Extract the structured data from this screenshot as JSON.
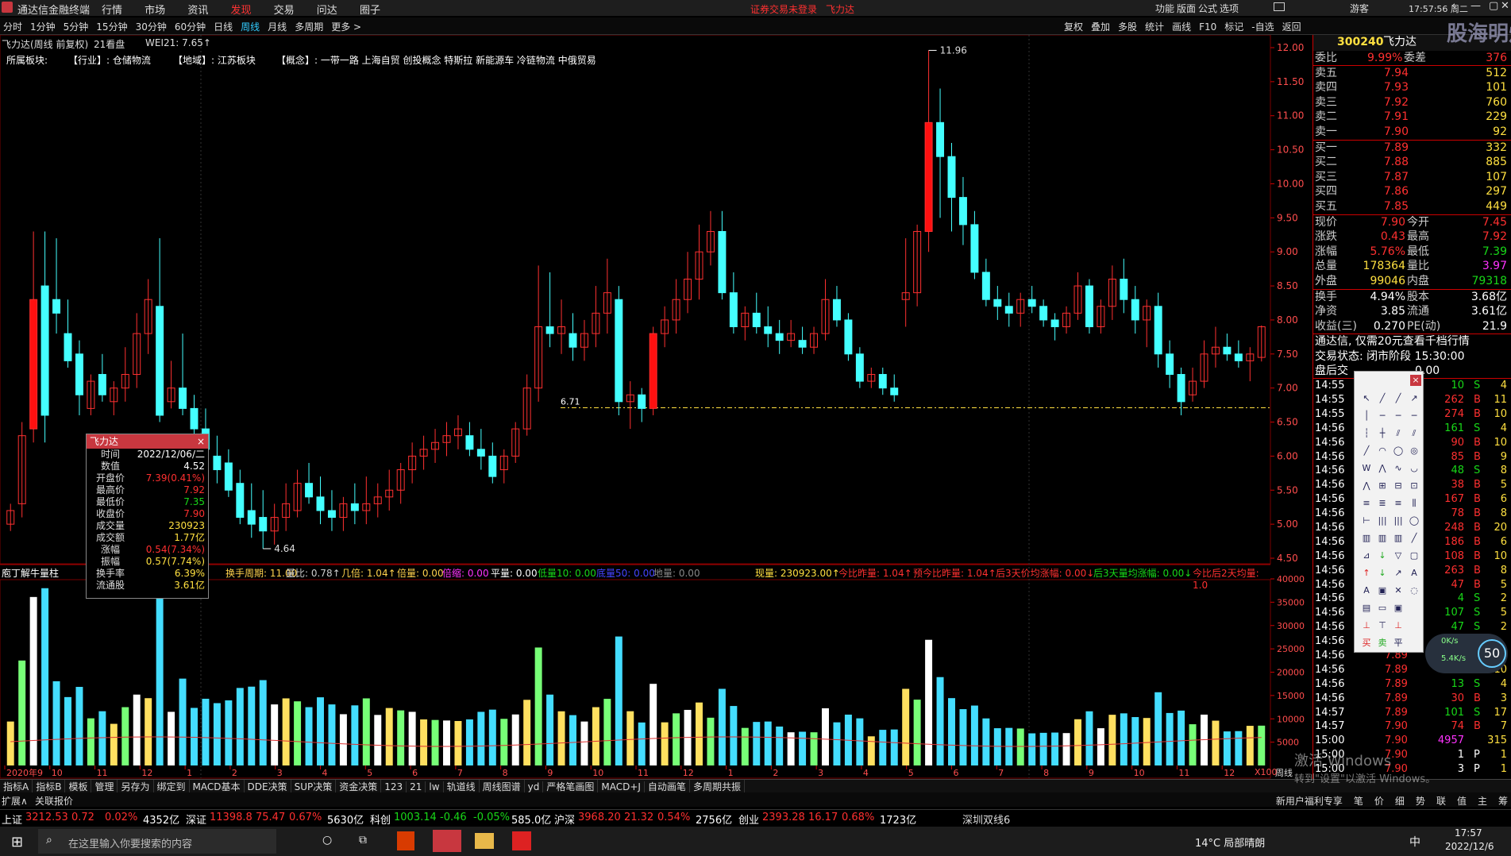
{
  "app": {
    "title": "通达信金融终端",
    "menu": [
      "行情",
      "市场",
      "资讯",
      "发现",
      "交易",
      "问达",
      "圈子"
    ],
    "center_notice": "证券交易未登录",
    "center_stock": "飞力达",
    "right_menu": [
      "功能",
      "版面",
      "公式",
      "选项"
    ],
    "user": "游客",
    "clock": "17:57:56 周二"
  },
  "period_tabs": [
    "分时",
    "1分钟",
    "5分钟",
    "15分钟",
    "30分钟",
    "60分钟",
    "日线",
    "周线",
    "月线",
    "多周期",
    "更多 >"
  ],
  "active_period": "周线",
  "toolbar_right": [
    "复权",
    "叠加",
    "多股",
    "统计",
    "画线",
    "F10",
    "标记",
    "-自选",
    "返回"
  ],
  "stock_info": {
    "name": "飞力达(周线 前复权)",
    "seal": "21看盘",
    "indicator": "WEI21: 7.65↑"
  },
  "sectors": {
    "label": "所属板块:",
    "industry": "【行业】: 仓储物流",
    "region": "【地域】: 江苏板块",
    "concept": "【概念】: 一带一路 上海自贸 创投概念 特斯拉 新能源车 冷链物流 中俄贸易"
  },
  "price_axis": [
    "12.00",
    "11.50",
    "11.00",
    "10.50",
    "10.00",
    "9.50",
    "9.00",
    "8.50",
    "8.00",
    "7.50",
    "7.00",
    "6.50",
    "6.00",
    "5.50",
    "5.00",
    "4.50"
  ],
  "price_marks": {
    "high": "11.96",
    "low": "4.64",
    "level": "6.71"
  },
  "volume_axis": [
    "40000",
    "35000",
    "30000",
    "25000",
    "20000",
    "15000",
    "10000",
    "5000",
    "X100"
  ],
  "x_axis_labels": [
    "2020年9",
    "10",
    "11",
    "12",
    "1",
    "2",
    "3",
    "4",
    "5",
    "6",
    "7",
    "8",
    "9",
    "10",
    "11",
    "12",
    "1",
    "2",
    "3",
    "4",
    "5",
    "6",
    "7",
    "8",
    "9",
    "10",
    "11",
    "12"
  ],
  "volume_indicator": {
    "name": "庖丁解牛量柱",
    "items": [
      "换手周期: 11.00",
      "量比: 0.78↑",
      "几倍: 1.04↑",
      "倍量: 0.00",
      "倍缩: 0.00",
      "平量: 0.00",
      "低量10: 0.00",
      "底量50: 0.00",
      "地量: 0.00",
      "现量: 230923.00↑",
      "今比昨量: 1.04↑",
      "预今比昨量: 1.04↑",
      "后3天价均涨幅: 0.00↓",
      "后3天量均涨幅: 0.00↓",
      "今比后2天均量: 1.0"
    ]
  },
  "popup": {
    "title": "飞力达",
    "rows": [
      [
        "时间",
        "2022/12/06/二"
      ],
      [
        "数值",
        "4.52"
      ],
      [
        "开盘价",
        "7.39(0.41%)"
      ],
      [
        "最高价",
        "7.92"
      ],
      [
        "最低价",
        "7.35"
      ],
      [
        "收盘价",
        "7.90"
      ],
      [
        "成交量",
        "230923"
      ],
      [
        "成交额",
        "1.77亿"
      ],
      [
        "涨幅",
        "0.54(7.34%)"
      ],
      [
        "振幅",
        "0.57(7.74%)"
      ],
      [
        "换手率",
        "6.39%"
      ],
      [
        "流通股",
        "3.61亿"
      ]
    ]
  },
  "quote": {
    "code": "300240",
    "name": "飞力达",
    "weibi": [
      "委比",
      "9.99%",
      "委差",
      "376"
    ],
    "asks": [
      [
        "卖五",
        "7.94",
        "512"
      ],
      [
        "卖四",
        "7.93",
        "101"
      ],
      [
        "卖三",
        "7.92",
        "760"
      ],
      [
        "卖二",
        "7.91",
        "229"
      ],
      [
        "卖一",
        "7.90",
        "92"
      ]
    ],
    "bids": [
      [
        "买一",
        "7.89",
        "332"
      ],
      [
        "买二",
        "7.88",
        "885"
      ],
      [
        "买三",
        "7.87",
        "107"
      ],
      [
        "买四",
        "7.86",
        "297"
      ],
      [
        "买五",
        "7.85",
        "449"
      ]
    ],
    "stats": [
      [
        "现价",
        "7.90",
        "今开",
        "7.45"
      ],
      [
        "涨跌",
        "0.43",
        "最高",
        "7.92"
      ],
      [
        "涨幅",
        "5.76%",
        "最低",
        "7.39"
      ],
      [
        "总量",
        "178364",
        "量比",
        "3.97"
      ],
      [
        "外盘",
        "99046",
        "内盘",
        "79318"
      ]
    ],
    "stats2": [
      [
        "换手",
        "4.94%",
        "股本",
        "3.68亿"
      ],
      [
        "净资",
        "3.85",
        "流通",
        "3.61亿"
      ],
      [
        "收益(三)",
        "0.270",
        "PE(动)",
        "21.9"
      ]
    ],
    "notice": "通达信, 仅需20元查看千档行情",
    "trade_state": "交易状态: 闭市阶段 15:30:00",
    "after_hours": "盘后交",
    "after_hours_value": "0.00",
    "ticks": [
      [
        "14:55",
        "",
        "10",
        "S",
        "4"
      ],
      [
        "14:55",
        "",
        "262",
        "B",
        "11"
      ],
      [
        "14:55",
        "",
        "274",
        "B",
        "10"
      ],
      [
        "14:56",
        "",
        "161",
        "S",
        "4"
      ],
      [
        "14:56",
        "",
        "90",
        "B",
        "10"
      ],
      [
        "14:56",
        "",
        "85",
        "B",
        "9"
      ],
      [
        "14:56",
        "",
        "48",
        "S",
        "8"
      ],
      [
        "14:56",
        "",
        "38",
        "B",
        "5"
      ],
      [
        "14:56",
        "",
        "167",
        "B",
        "6"
      ],
      [
        "14:56",
        "",
        "78",
        "B",
        "8"
      ],
      [
        "14:56",
        "",
        "248",
        "B",
        "20"
      ],
      [
        "14:56",
        "",
        "186",
        "B",
        "6"
      ],
      [
        "14:56",
        "",
        "108",
        "B",
        "10"
      ],
      [
        "14:56",
        "",
        "263",
        "B",
        "8"
      ],
      [
        "14:56",
        "",
        "47",
        "B",
        "5"
      ],
      [
        "14:56",
        "",
        "4",
        "S",
        "2"
      ],
      [
        "14:56",
        "",
        "107",
        "S",
        "5"
      ],
      [
        "14:56",
        "",
        "47",
        "S",
        "2"
      ],
      [
        "14:56",
        "",
        "",
        "",
        ""
      ],
      [
        "14:56",
        "7.89",
        "",
        "",
        ""
      ],
      [
        "14:56",
        "7.89",
        "273",
        "B",
        "10"
      ],
      [
        "14:56",
        "7.89",
        "13",
        "S",
        "4"
      ],
      [
        "14:56",
        "7.89",
        "30",
        "B",
        "3"
      ],
      [
        "14:57",
        "7.89",
        "101",
        "S",
        "17"
      ],
      [
        "14:57",
        "7.90",
        "74",
        "B",
        "7"
      ],
      [
        "15:00",
        "7.90",
        "4957",
        "",
        "315"
      ],
      [
        "15:00",
        "7.90",
        "1",
        "P",
        "1"
      ],
      [
        "15:00",
        "7.90",
        "3",
        "P",
        "1"
      ]
    ]
  },
  "bottom_tabs1": [
    "指标A",
    "指标B",
    "模板",
    "管理",
    "另存为",
    "绑定到",
    "MACD基本",
    "DDE决策",
    "SUP决策",
    "资金决策",
    "123",
    "21",
    "lw",
    "轨道线",
    "周线图谱",
    "yd",
    "严格笔画图",
    "MACD+J",
    "自动画笔",
    "多周期共振"
  ],
  "bottom_tabs2": [
    "扩展∧",
    "关联报价"
  ],
  "bottom_right_tabs": [
    "新用户福利专享",
    "笔",
    "价",
    "细",
    "势",
    "联",
    "值",
    "主",
    "筹"
  ],
  "status": [
    [
      "上证",
      "3212.53",
      "0.72",
      "0.02%",
      "4352亿"
    ],
    [
      "深证",
      "11398.8",
      "75.47",
      "0.67%",
      "5630亿"
    ],
    [
      "科创",
      "1003.14",
      "-0.46",
      "-0.05%",
      "585.0亿"
    ],
    [
      "沪深",
      "3968.20",
      "21.32",
      "0.54%",
      "2756亿"
    ],
    [
      "创业",
      "2393.28",
      "16.17",
      "0.68%",
      "1723亿"
    ]
  ],
  "status_right": "深圳双线6",
  "taskbar": {
    "search_placeholder": "在这里输入你要搜索的内容",
    "weather": "14°C 局部晴朗",
    "time": "17:57",
    "date": "2022/12/6",
    "ime": "中"
  },
  "watermark": [
    "激活 Windows",
    "转到\"设置\"以激活 Windows。"
  ],
  "net_speed": [
    "0K/s",
    "5.4K/s"
  ],
  "net_percent": "50",
  "cursor_label": "周线",
  "right_logo": "股海明灯",
  "colors": {
    "up": "#ff3030",
    "down": "#44ffff",
    "accent": "#c8373f"
  },
  "chart_data": {
    "type": "candlestick",
    "period": "weekly",
    "ylim": [
      4.5,
      12.0
    ],
    "ohlc": [
      [
        5.0,
        5.3,
        4.9,
        5.2
      ],
      [
        5.3,
        6.5,
        5.1,
        6.3
      ],
      [
        6.4,
        9.3,
        6.2,
        8.3
      ],
      [
        8.5,
        9.3,
        6.2,
        6.6
      ],
      [
        8.3,
        9.2,
        7.8,
        8.1
      ],
      [
        7.8,
        8.3,
        7.3,
        7.4
      ],
      [
        7.5,
        7.7,
        6.6,
        6.9
      ],
      [
        6.7,
        7.2,
        6.6,
        7.1
      ],
      [
        7.2,
        7.5,
        6.8,
        6.9
      ],
      [
        6.8,
        7.1,
        6.6,
        7.0
      ],
      [
        7.0,
        7.6,
        6.8,
        7.2
      ],
      [
        7.2,
        8.1,
        7.0,
        7.8
      ],
      [
        7.8,
        8.6,
        7.5,
        8.3
      ],
      [
        8.2,
        9.2,
        6.5,
        6.6
      ],
      [
        6.8,
        7.4,
        6.7,
        7.0
      ],
      [
        7.0,
        7.8,
        6.6,
        6.7
      ],
      [
        6.7,
        6.9,
        6.2,
        6.4
      ],
      [
        6.4,
        6.7,
        5.9,
        6.1
      ],
      [
        6.0,
        6.3,
        5.6,
        5.8
      ],
      [
        5.9,
        6.1,
        5.4,
        5.5
      ],
      [
        5.6,
        5.8,
        5.0,
        5.1
      ],
      [
        5.2,
        5.6,
        4.8,
        5.0
      ],
      [
        5.1,
        5.5,
        4.64,
        4.9
      ],
      [
        4.9,
        5.3,
        4.7,
        5.1
      ],
      [
        5.1,
        5.6,
        4.9,
        5.3
      ],
      [
        5.2,
        5.8,
        5.1,
        5.6
      ],
      [
        5.6,
        5.9,
        5.3,
        5.4
      ],
      [
        5.4,
        5.7,
        5.0,
        5.2
      ],
      [
        5.2,
        5.5,
        4.9,
        5.1
      ],
      [
        5.1,
        5.4,
        4.9,
        5.3
      ],
      [
        5.3,
        5.6,
        5.0,
        5.2
      ],
      [
        5.2,
        5.7,
        5.0,
        5.3
      ],
      [
        5.3,
        5.6,
        5.1,
        5.4
      ],
      [
        5.4,
        5.8,
        5.2,
        5.5
      ],
      [
        5.5,
        5.9,
        5.3,
        5.8
      ],
      [
        5.8,
        6.2,
        5.6,
        6.0
      ],
      [
        6.0,
        6.3,
        5.8,
        6.1
      ],
      [
        6.1,
        6.4,
        5.9,
        6.2
      ],
      [
        6.2,
        6.5,
        6.0,
        6.3
      ],
      [
        6.3,
        6.6,
        6.1,
        6.4
      ],
      [
        6.3,
        6.5,
        6.0,
        6.1
      ],
      [
        6.1,
        6.4,
        5.8,
        6.0
      ],
      [
        6.0,
        6.2,
        5.6,
        5.7
      ],
      [
        5.8,
        6.1,
        5.6,
        6.0
      ],
      [
        6.0,
        6.5,
        5.9,
        6.4
      ],
      [
        6.4,
        7.2,
        6.3,
        7.0
      ],
      [
        7.0,
        8.8,
        6.8,
        7.9
      ],
      [
        7.9,
        8.7,
        7.6,
        7.8
      ],
      [
        7.8,
        8.3,
        7.5,
        7.9
      ],
      [
        7.8,
        8.1,
        7.4,
        7.6
      ],
      [
        7.6,
        8.0,
        7.4,
        7.8
      ],
      [
        7.8,
        8.5,
        7.6,
        8.1
      ],
      [
        8.1,
        8.9,
        7.8,
        8.4
      ],
      [
        8.3,
        8.5,
        6.6,
        6.8
      ],
      [
        6.8,
        7.1,
        6.4,
        6.9
      ],
      [
        6.9,
        7.0,
        6.5,
        6.7
      ],
      [
        6.7,
        7.9,
        6.6,
        7.8
      ],
      [
        7.8,
        8.2,
        7.6,
        8.0
      ],
      [
        8.0,
        8.6,
        7.8,
        8.3
      ],
      [
        8.3,
        9.0,
        8.1,
        8.6
      ],
      [
        8.6,
        9.4,
        8.3,
        9.0
      ],
      [
        9.0,
        9.6,
        8.8,
        9.3
      ],
      [
        9.3,
        9.6,
        8.3,
        8.4
      ],
      [
        8.4,
        8.7,
        7.8,
        7.9
      ],
      [
        7.9,
        8.2,
        7.7,
        8.1
      ],
      [
        8.1,
        8.4,
        7.8,
        7.9
      ],
      [
        7.9,
        8.2,
        7.6,
        7.8
      ],
      [
        7.8,
        8.0,
        7.5,
        7.7
      ],
      [
        7.7,
        8.0,
        7.6,
        7.8
      ],
      [
        7.7,
        7.9,
        7.5,
        7.6
      ],
      [
        7.6,
        7.9,
        7.5,
        7.8
      ],
      [
        7.8,
        8.6,
        7.7,
        8.3
      ],
      [
        8.3,
        8.5,
        7.9,
        8.0
      ],
      [
        8.0,
        8.1,
        7.4,
        7.5
      ],
      [
        7.5,
        7.6,
        7.0,
        7.1
      ],
      [
        7.1,
        7.3,
        7.0,
        7.2
      ],
      [
        7.2,
        7.3,
        6.9,
        7.0
      ],
      [
        7.0,
        7.2,
        6.8,
        6.9
      ],
      [
        8.3,
        9.2,
        7.9,
        8.4
      ],
      [
        8.4,
        9.4,
        8.2,
        9.3
      ],
      [
        9.3,
        11.96,
        9.0,
        10.9
      ],
      [
        10.9,
        11.4,
        9.5,
        10.4
      ],
      [
        10.4,
        10.6,
        9.3,
        9.8
      ],
      [
        9.8,
        10.1,
        9.1,
        9.4
      ],
      [
        9.4,
        9.6,
        8.6,
        8.7
      ],
      [
        8.7,
        8.9,
        8.2,
        8.3
      ],
      [
        8.3,
        8.5,
        8.0,
        8.2
      ],
      [
        8.2,
        8.4,
        7.9,
        8.1
      ],
      [
        8.1,
        8.4,
        7.9,
        8.3
      ],
      [
        8.3,
        8.5,
        8.1,
        8.2
      ],
      [
        8.2,
        8.3,
        7.9,
        8.0
      ],
      [
        8.0,
        8.1,
        7.7,
        7.9
      ],
      [
        7.9,
        8.2,
        7.8,
        8.1
      ],
      [
        8.1,
        8.7,
        8.0,
        8.5
      ],
      [
        8.5,
        8.6,
        7.8,
        7.9
      ],
      [
        7.9,
        8.3,
        7.8,
        8.2
      ],
      [
        8.2,
        8.8,
        8.0,
        8.6
      ],
      [
        8.6,
        8.9,
        8.1,
        8.3
      ],
      [
        8.3,
        8.5,
        7.8,
        8.0
      ],
      [
        8.0,
        8.3,
        7.6,
        8.2
      ],
      [
        8.2,
        8.4,
        7.3,
        7.5
      ],
      [
        7.5,
        7.7,
        7.0,
        7.2
      ],
      [
        7.2,
        7.3,
        6.6,
        6.8
      ],
      [
        6.9,
        7.3,
        6.8,
        7.1
      ],
      [
        7.1,
        7.7,
        7.0,
        7.5
      ],
      [
        7.5,
        7.9,
        7.3,
        7.6
      ],
      [
        7.6,
        7.8,
        7.4,
        7.5
      ],
      [
        7.5,
        7.7,
        7.3,
        7.4
      ],
      [
        7.4,
        7.6,
        7.1,
        7.5
      ],
      [
        7.45,
        7.92,
        7.39,
        7.9
      ]
    ],
    "volume_ylim": [
      0,
      40000
    ]
  }
}
